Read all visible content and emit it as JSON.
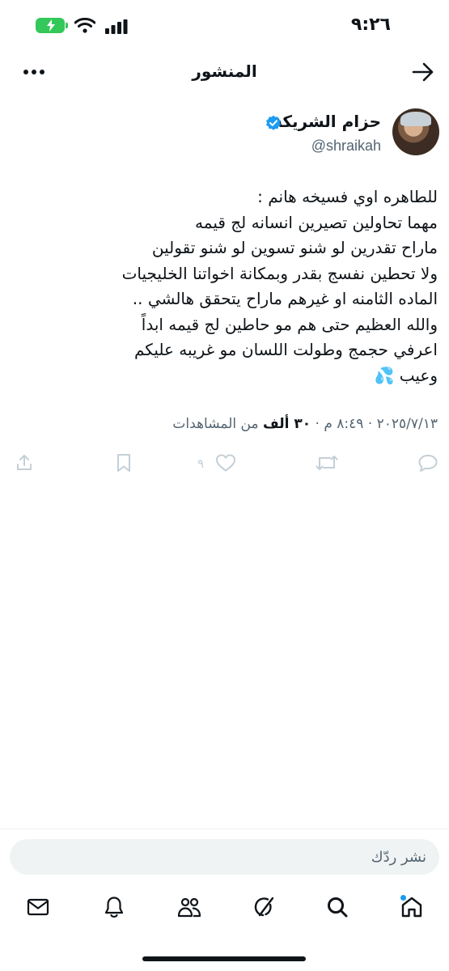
{
  "status_bar": {
    "time": "٩:٢٦"
  },
  "header": {
    "title": "المنشور"
  },
  "post": {
    "author_name": "حزام الشريكة",
    "author_handle": "@shraikah",
    "lines": [
      "للطاهره اوي فسيخه هانم :",
      "مهما تحاولين تصيرين انسانه لج قيمه",
      "ماراح تقدرين لو شنو تسوين لو شنو تقولين",
      "ولا تحطين نفسج بقدر وبمكانة اخواتنا الخليجيات",
      "الماده الثامنه او غيرهم ماراح يتحقق هالشي ..",
      "والله العظيم حتى هم مو حاطين لج قيمه ابداً",
      "اعرفي حجمج وطولت اللسان مو غريبه عليكم",
      "وعيب 💦"
    ],
    "meta": {
      "date": "٢٠٢٥/٧/١٣",
      "separator": "·",
      "time": "٨:٤٩ م",
      "views_count": "٣٠ ألف",
      "views_label": "من المشاهدات"
    },
    "likes_count": "٩"
  },
  "reply": {
    "placeholder": "نشر ردّك"
  },
  "icons": {
    "back": "arrow-right-icon",
    "more": "more-horizontal-icon",
    "verified": "verified-badge-icon",
    "reply": "comment-icon",
    "repost": "repost-icon",
    "like": "heart-icon",
    "bookmark": "bookmark-icon",
    "share": "share-icon",
    "tabs": [
      "home-icon",
      "search-icon",
      "grok-icon",
      "people-icon",
      "bell-icon",
      "mail-icon"
    ]
  },
  "colors": {
    "accent": "#1d9bf0",
    "text": "#0f1419",
    "secondary": "#536471",
    "battery": "#34c759"
  }
}
